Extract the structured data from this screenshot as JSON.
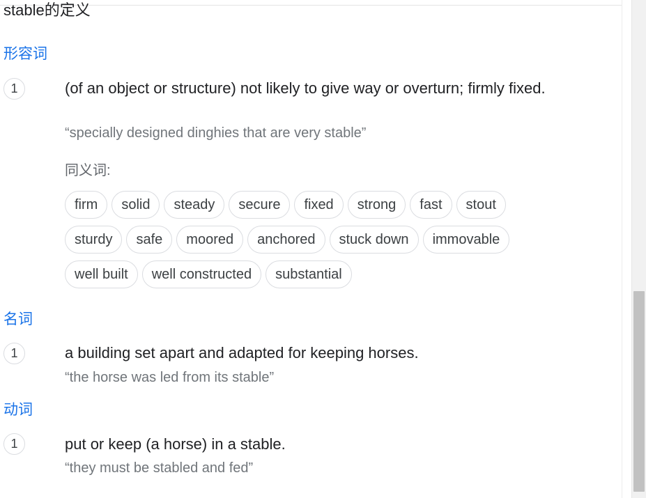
{
  "title": "stable的定义",
  "adjective": {
    "pos_label": "形容词",
    "number": "1",
    "definition": "(of an object or structure) not likely to give way or overturn; firmly fixed.",
    "example": "“specially designed dinghies that are very stable”",
    "synonyms_label": "同义词:",
    "synonyms": [
      "firm",
      "solid",
      "steady",
      "secure",
      "fixed",
      "strong",
      "fast",
      "stout",
      "sturdy",
      "safe",
      "moored",
      "anchored",
      "stuck down",
      "immovable",
      "well built",
      "well constructed",
      "substantial"
    ]
  },
  "noun": {
    "pos_label": "名词",
    "number": "1",
    "definition": "a building set apart and adapted for keeping horses.",
    "example": "“the horse was led from its stable”"
  },
  "verb": {
    "pos_label": "动词",
    "number": "1",
    "definition": "put or keep (a horse) in a stable.",
    "example": "“they must be stabled and fed”"
  }
}
